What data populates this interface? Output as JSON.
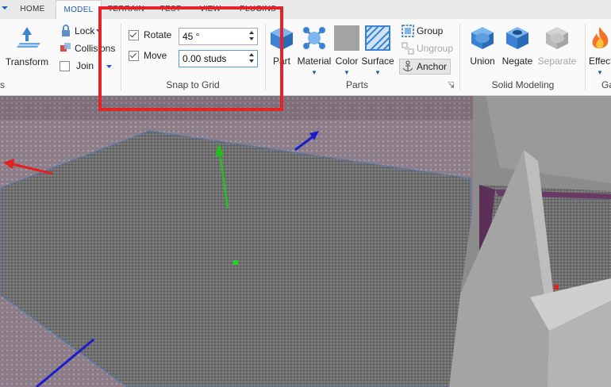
{
  "tabs": [
    {
      "label": "HOME",
      "active": false
    },
    {
      "label": "MODEL",
      "active": true
    },
    {
      "label": "TERRAIN",
      "active": false
    },
    {
      "label": "TEST",
      "active": false
    },
    {
      "label": "VIEW",
      "active": false
    },
    {
      "label": "PLUGINS",
      "active": false
    }
  ],
  "ribbon": {
    "transform_label": "Transform",
    "tools_group_label": "s",
    "lock_label": "Lock",
    "collisions_label": "Collisions",
    "join_label": "Join",
    "snap": {
      "rotate_label": "Rotate",
      "rotate_checked": true,
      "rotate_value": "45 °",
      "move_label": "Move",
      "move_checked": true,
      "move_value": "0.00 studs",
      "group_label": "Snap to Grid"
    },
    "parts": {
      "part_label": "Part",
      "material_label": "Material",
      "color_label": "Color",
      "surface_label": "Surface",
      "group_btn_label": "Group",
      "ungroup_label": "Ungroup",
      "anchor_label": "Anchor",
      "group_label": "Parts"
    },
    "solid": {
      "union_label": "Union",
      "negate_label": "Negate",
      "separate_label": "Separate",
      "group_label": "Solid Modeling"
    },
    "effects_label": "Effect",
    "gameplay_label": "Ga"
  },
  "icons": {
    "menu": "chevron-down-icon",
    "transform": "transform-icon",
    "lock": "lock-icon",
    "collisions": "collisions-icon",
    "join": "join-icon",
    "part": "part-cube-icon",
    "material": "material-icon",
    "color": "color-swatch-icon",
    "surface": "surface-icon",
    "group": "group-icon",
    "ungroup": "ungroup-icon",
    "anchor": "anchor-icon",
    "union": "union-icon",
    "negate": "negate-icon",
    "separate": "separate-icon",
    "effects": "fire-icon"
  },
  "colors": {
    "accent": "#1a5fb4",
    "highlight": "#e2232a",
    "axis_x": "#e0221f",
    "axis_y": "#22c21e",
    "axis_z": "#1c1ccf",
    "color_swatch": "#a3a3a3"
  }
}
